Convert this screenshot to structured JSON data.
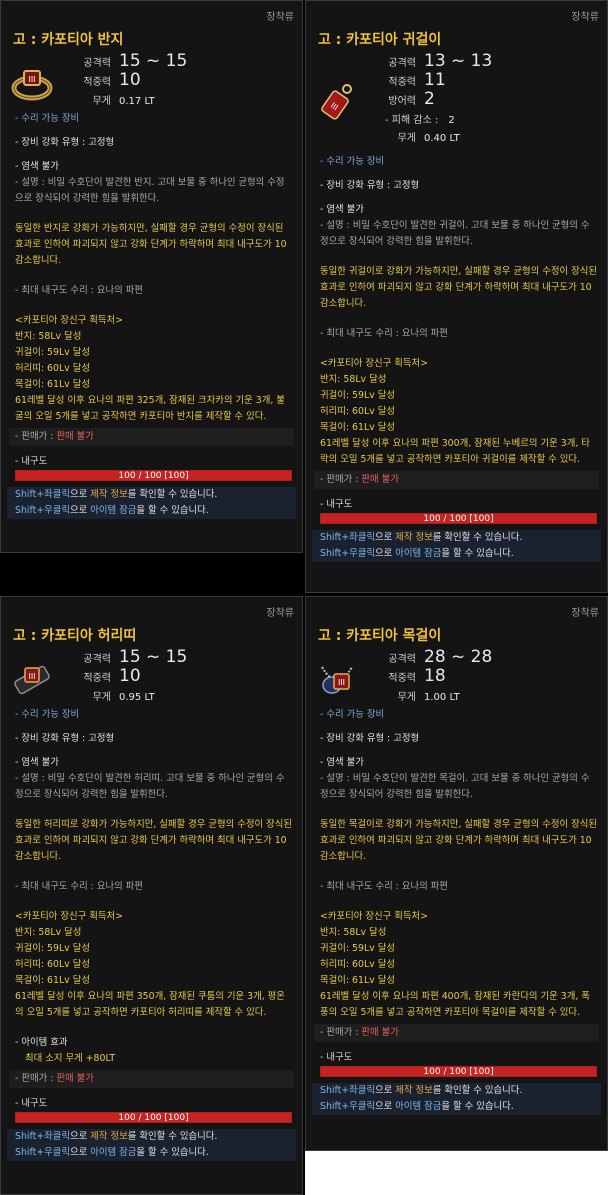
{
  "tooltips": [
    {
      "category": "장착류",
      "name": "고 : 카포티아 반지",
      "icon": "ring-icon",
      "stats": [
        {
          "label": "공격력",
          "value": "15 ~ 15"
        },
        {
          "label": "적중력",
          "value": "10"
        },
        {
          "label": "무게",
          "value": "0.17 LT"
        }
      ],
      "repair": "- 수리 가능 장비",
      "enhance_type": "- 장비 강화 유형 : 고정형",
      "dye": "- 염색 불가",
      "desc": "- 설명 : 비밀 수호단이 발견한 반지. 고대 보물 중 하나인 균형의 수정으로 장식되어 강력한 힘을 발휘한다.",
      "enhance_note": "동일한 반지로 강화가 가능하지만, 실패할 경우 균형의 수정이 장식된 효과로 인하여 파괴되지 않고 강화 단계가 하락하며 최대 내구도가 10 감소합니다.",
      "max_dur_repair": "- 최대 내구도 수리 : 요나의 파편",
      "acq_title": "<카포티아 장신구 획득처>",
      "acq_lines": [
        "반지: 58Lv 달성",
        "귀걸이: 59Lv 달성",
        "허리띠: 60Lv 달성",
        "목걸이: 61Lv 달성"
      ],
      "craft_note": "61레벨 달성 이후 요나의 파편 325개, 잠재된 크자카의 기운 3개, 불굴의 오일 5개를 넣고 공작하면 카포티아 반지를 제작할 수 있다.",
      "sale_label": "- 판매가 :",
      "sale_value": "판매 불가",
      "durability_label": "- 내구도",
      "durability_text": "100 / 100 [100]",
      "durability_pct": 100,
      "hint1": {
        "key": "Shift+좌클릭",
        "mid": "으로 ",
        "obj": "제작 정보",
        "end": "를 확인할 수 있습니다."
      },
      "hint2": {
        "key": "Shift+우클릭",
        "mid": "으로 ",
        "obj": "아이템 잠금",
        "end": "을 할 수 있습니다."
      }
    },
    {
      "category": "장착류",
      "name": "고 : 카포티아 귀걸이",
      "icon": "earring-icon",
      "stats": [
        {
          "label": "공격력",
          "value": "13 ~ 13"
        },
        {
          "label": "적중력",
          "value": "11"
        },
        {
          "label": "방어력",
          "value": "2"
        }
      ],
      "sub_stat": {
        "label": "- 피해 감소 :",
        "value": "2"
      },
      "weight": {
        "label": "무게",
        "value": "0.40 LT"
      },
      "repair": "- 수리 가능 장비",
      "enhance_type": "- 장비 강화 유형 : 고정형",
      "dye": "- 염색 불가",
      "desc": "- 설명 : 비밀 수호단이 발견한 귀걸이. 고대 보물 중 하나인 균형의 수정으로 장식되어 강력한 힘을 발휘한다.",
      "enhance_note": "동일한 귀걸이로 강화가 가능하지만, 실패할 경우 균형의 수정이 장식된 효과로 인하여 파괴되지 않고 강화 단계가 하락하며 최대 내구도가 10 감소합니다.",
      "max_dur_repair": "- 최대 내구도 수리 : 요나의 파편",
      "acq_title": "<카포티아 장신구 획득처>",
      "acq_lines": [
        "반지: 58Lv 달성",
        "귀걸이: 59Lv 달성",
        "허리띠: 60Lv 달성",
        "목걸이: 61Lv 달성"
      ],
      "craft_note": "61레벨 달성 이후 요나의 파편 300개, 잠재된 누베르의 기운 3개, 타락의 오일 5개를 넣고 공작하면 카포티아 귀걸이를 제작할 수 있다.",
      "sale_label": "- 판매가 :",
      "sale_value": "판매 불가",
      "durability_label": "- 내구도",
      "durability_text": "100 / 100 [100]",
      "durability_pct": 100,
      "hint1": {
        "key": "Shift+좌클릭",
        "mid": "으로 ",
        "obj": "제작 정보",
        "end": "를 확인할 수 있습니다."
      },
      "hint2": {
        "key": "Shift+우클릭",
        "mid": "으로 ",
        "obj": "아이템 잠금",
        "end": "을 할 수 있습니다."
      }
    },
    {
      "category": "장착류",
      "name": "고 : 카포티아 허리띠",
      "icon": "belt-icon",
      "stats": [
        {
          "label": "공격력",
          "value": "15 ~ 15"
        },
        {
          "label": "적중력",
          "value": "10"
        },
        {
          "label": "무게",
          "value": "0.95 LT"
        }
      ],
      "repair": "- 수리 가능 장비",
      "enhance_type": "- 장비 강화 유형 : 고정형",
      "dye": "- 염색 불가",
      "desc": "- 설명 : 비밀 수호단이 발견한 허리띠. 고대 보물 중 하나인 균형의 수정으로 장식되어 강력한 힘을 발휘한다.",
      "enhance_note": "동일한 허리띠로 강화가 가능하지만, 실패할 경우 균형의 수정이 장식된 효과로 인하여 파괴되지 않고 강화 단계가 하락하며 최대 내구도가 10 감소합니다.",
      "max_dur_repair": "- 최대 내구도 수리 : 요나의 파편",
      "acq_title": "<카포티아 장신구 획득처>",
      "acq_lines": [
        "반지: 58Lv 달성",
        "귀걸이: 59Lv 달성",
        "허리띠: 60Lv 달성",
        "목걸이: 61Lv 달성"
      ],
      "craft_note": "61레벨 달성 이후 요나의 파편 350개, 잠재된 쿠툼의 기운 3개, 평온의 오일 5개를 넣고 공작하면 카포티아 허리띠를 제작할 수 있다.",
      "item_effect_label": "- 아이템 효과",
      "item_effect_value": "최대 소지 무게 +80LT",
      "sale_label": "- 판매가 :",
      "sale_value": "판매 불가",
      "durability_label": "- 내구도",
      "durability_text": "100 / 100 [100]",
      "durability_pct": 100,
      "hint1": {
        "key": "Shift+좌클릭",
        "mid": "으로 ",
        "obj": "제작 정보",
        "end": "를 확인할 수 있습니다."
      },
      "hint2": {
        "key": "Shift+우클릭",
        "mid": "으로 ",
        "obj": "아이템 잠금",
        "end": "을 할 수 있습니다."
      }
    },
    {
      "category": "장착류",
      "name": "고 : 카포티아 목걸이",
      "icon": "necklace-icon",
      "stats": [
        {
          "label": "공격력",
          "value": "28 ~ 28"
        },
        {
          "label": "적중력",
          "value": "18"
        },
        {
          "label": "무게",
          "value": "1.00 LT"
        }
      ],
      "repair": "- 수리 가능 장비",
      "enhance_type": "- 장비 강화 유형 : 고정형",
      "dye": "- 염색 불가",
      "desc": "- 설명 : 비밀 수호단이 발견한 목걸이. 고대 보물 중 하나인 균형의 수정으로 장식되어 강력한 힘을 발휘한다.",
      "enhance_note": "동일한 목걸이로 강화가 가능하지만, 실패할 경우 균형의 수정이 장식된 효과로 인하여 파괴되지 않고 강화 단계가 하락하며 최대 내구도가 10 감소합니다.",
      "max_dur_repair": "- 최대 내구도 수리 : 요나의 파편",
      "acq_title": "<카포티아 장신구 획득처>",
      "acq_lines": [
        "반지: 58Lv 달성",
        "귀걸이: 59Lv 달성",
        "허리띠: 60Lv 달성",
        "목걸이: 61Lv 달성"
      ],
      "craft_note": "61레벨 달성 이후 요나의 파편 400개, 잠재된 카란다의 기운 3개, 폭풍의 오일 5개를 넣고 공작하면 카포티아 목걸이를 제작할 수 있다.",
      "sale_label": "- 판매가 :",
      "sale_value": "판매 불가",
      "durability_label": "- 내구도",
      "durability_text": "100 / 100 [100]",
      "durability_pct": 100,
      "hint1": {
        "key": "Shift+좌클릭",
        "mid": "으로 ",
        "obj": "제작 정보",
        "end": "를 확인할 수 있습니다."
      },
      "hint2": {
        "key": "Shift+우클릭",
        "mid": "으로 ",
        "obj": "아이템 잠금",
        "end": "을 할 수 있습니다."
      }
    }
  ]
}
